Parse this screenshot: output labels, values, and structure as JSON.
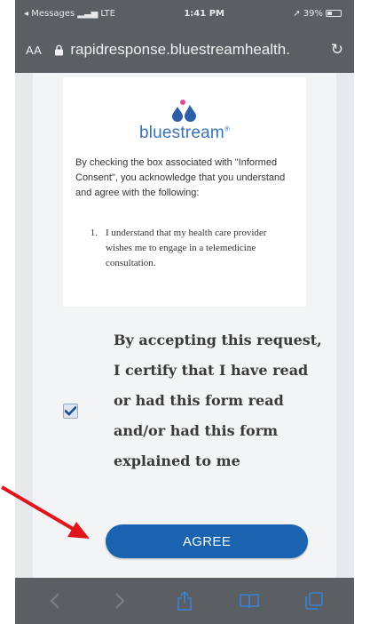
{
  "status_bar": {
    "back_app": "◂ Messages",
    "network": "LTE",
    "time": "1:41 PM",
    "battery": "39%"
  },
  "url_bar": {
    "text_size_label": "AA",
    "url": "rapidresponse.bluestreamhealth."
  },
  "consent": {
    "brand": "bluestream",
    "brand_mark": "®",
    "intro": "By checking the box associated with \"Informed Consent\", you acknowledge that you understand and agree with the following:",
    "items": [
      {
        "number": "1.",
        "text": "I understand that my health care provider wishes me to engage in a telemedicine consultation."
      }
    ],
    "checkbox_checked": true,
    "certify_text": "By accepting this request, I certify that I have read or had this form read and/or had this form explained to me",
    "agree_label": "AGREE"
  },
  "toolbar": {
    "icons": [
      "back-icon",
      "forward-icon",
      "share-icon",
      "bookmarks-icon",
      "tabs-icon"
    ]
  },
  "colors": {
    "brand_blue": "#3973b8",
    "drop_pink": "#e0479e",
    "button_blue": "#1a63b0",
    "annotation_red": "#e0141b",
    "chrome_gray": "#5b5e62"
  }
}
